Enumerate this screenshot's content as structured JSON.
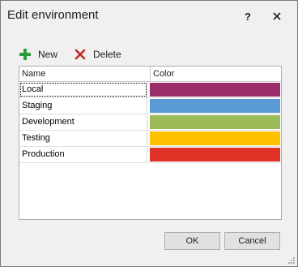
{
  "window": {
    "title": "Edit environment",
    "help_glyph": "?",
    "close_glyph": "✕"
  },
  "toolbar": {
    "new_label": "New",
    "delete_label": "Delete",
    "new_icon": "plus-icon",
    "delete_icon": "delete-x-icon"
  },
  "grid": {
    "columns": [
      "Name",
      "Color"
    ],
    "rows": [
      {
        "name": "Local",
        "color": "#9b2d6a"
      },
      {
        "name": "Staging",
        "color": "#5b9bd5"
      },
      {
        "name": "Development",
        "color": "#9bbb59"
      },
      {
        "name": "Testing",
        "color": "#ffc000"
      },
      {
        "name": "Production",
        "color": "#e03126"
      }
    ],
    "selected_row": "Local"
  },
  "buttons": {
    "ok_label": "OK",
    "cancel_label": "Cancel"
  }
}
